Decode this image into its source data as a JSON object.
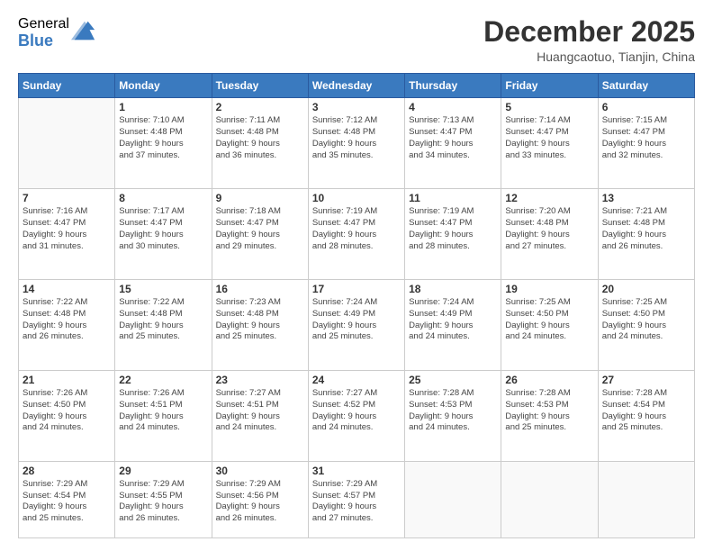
{
  "logo": {
    "general": "General",
    "blue": "Blue"
  },
  "title": "December 2025",
  "location": "Huangcaotuo, Tianjin, China",
  "weekdays": [
    "Sunday",
    "Monday",
    "Tuesday",
    "Wednesday",
    "Thursday",
    "Friday",
    "Saturday"
  ],
  "weeks": [
    [
      {
        "day": "",
        "info": ""
      },
      {
        "day": "1",
        "info": "Sunrise: 7:10 AM\nSunset: 4:48 PM\nDaylight: 9 hours\nand 37 minutes."
      },
      {
        "day": "2",
        "info": "Sunrise: 7:11 AM\nSunset: 4:48 PM\nDaylight: 9 hours\nand 36 minutes."
      },
      {
        "day": "3",
        "info": "Sunrise: 7:12 AM\nSunset: 4:48 PM\nDaylight: 9 hours\nand 35 minutes."
      },
      {
        "day": "4",
        "info": "Sunrise: 7:13 AM\nSunset: 4:47 PM\nDaylight: 9 hours\nand 34 minutes."
      },
      {
        "day": "5",
        "info": "Sunrise: 7:14 AM\nSunset: 4:47 PM\nDaylight: 9 hours\nand 33 minutes."
      },
      {
        "day": "6",
        "info": "Sunrise: 7:15 AM\nSunset: 4:47 PM\nDaylight: 9 hours\nand 32 minutes."
      }
    ],
    [
      {
        "day": "7",
        "info": "Sunrise: 7:16 AM\nSunset: 4:47 PM\nDaylight: 9 hours\nand 31 minutes."
      },
      {
        "day": "8",
        "info": "Sunrise: 7:17 AM\nSunset: 4:47 PM\nDaylight: 9 hours\nand 30 minutes."
      },
      {
        "day": "9",
        "info": "Sunrise: 7:18 AM\nSunset: 4:47 PM\nDaylight: 9 hours\nand 29 minutes."
      },
      {
        "day": "10",
        "info": "Sunrise: 7:19 AM\nSunset: 4:47 PM\nDaylight: 9 hours\nand 28 minutes."
      },
      {
        "day": "11",
        "info": "Sunrise: 7:19 AM\nSunset: 4:47 PM\nDaylight: 9 hours\nand 28 minutes."
      },
      {
        "day": "12",
        "info": "Sunrise: 7:20 AM\nSunset: 4:48 PM\nDaylight: 9 hours\nand 27 minutes."
      },
      {
        "day": "13",
        "info": "Sunrise: 7:21 AM\nSunset: 4:48 PM\nDaylight: 9 hours\nand 26 minutes."
      }
    ],
    [
      {
        "day": "14",
        "info": "Sunrise: 7:22 AM\nSunset: 4:48 PM\nDaylight: 9 hours\nand 26 minutes."
      },
      {
        "day": "15",
        "info": "Sunrise: 7:22 AM\nSunset: 4:48 PM\nDaylight: 9 hours\nand 25 minutes."
      },
      {
        "day": "16",
        "info": "Sunrise: 7:23 AM\nSunset: 4:48 PM\nDaylight: 9 hours\nand 25 minutes."
      },
      {
        "day": "17",
        "info": "Sunrise: 7:24 AM\nSunset: 4:49 PM\nDaylight: 9 hours\nand 25 minutes."
      },
      {
        "day": "18",
        "info": "Sunrise: 7:24 AM\nSunset: 4:49 PM\nDaylight: 9 hours\nand 24 minutes."
      },
      {
        "day": "19",
        "info": "Sunrise: 7:25 AM\nSunset: 4:50 PM\nDaylight: 9 hours\nand 24 minutes."
      },
      {
        "day": "20",
        "info": "Sunrise: 7:25 AM\nSunset: 4:50 PM\nDaylight: 9 hours\nand 24 minutes."
      }
    ],
    [
      {
        "day": "21",
        "info": "Sunrise: 7:26 AM\nSunset: 4:50 PM\nDaylight: 9 hours\nand 24 minutes."
      },
      {
        "day": "22",
        "info": "Sunrise: 7:26 AM\nSunset: 4:51 PM\nDaylight: 9 hours\nand 24 minutes."
      },
      {
        "day": "23",
        "info": "Sunrise: 7:27 AM\nSunset: 4:51 PM\nDaylight: 9 hours\nand 24 minutes."
      },
      {
        "day": "24",
        "info": "Sunrise: 7:27 AM\nSunset: 4:52 PM\nDaylight: 9 hours\nand 24 minutes."
      },
      {
        "day": "25",
        "info": "Sunrise: 7:28 AM\nSunset: 4:53 PM\nDaylight: 9 hours\nand 24 minutes."
      },
      {
        "day": "26",
        "info": "Sunrise: 7:28 AM\nSunset: 4:53 PM\nDaylight: 9 hours\nand 25 minutes."
      },
      {
        "day": "27",
        "info": "Sunrise: 7:28 AM\nSunset: 4:54 PM\nDaylight: 9 hours\nand 25 minutes."
      }
    ],
    [
      {
        "day": "28",
        "info": "Sunrise: 7:29 AM\nSunset: 4:54 PM\nDaylight: 9 hours\nand 25 minutes."
      },
      {
        "day": "29",
        "info": "Sunrise: 7:29 AM\nSunset: 4:55 PM\nDaylight: 9 hours\nand 26 minutes."
      },
      {
        "day": "30",
        "info": "Sunrise: 7:29 AM\nSunset: 4:56 PM\nDaylight: 9 hours\nand 26 minutes."
      },
      {
        "day": "31",
        "info": "Sunrise: 7:29 AM\nSunset: 4:57 PM\nDaylight: 9 hours\nand 27 minutes."
      },
      {
        "day": "",
        "info": ""
      },
      {
        "day": "",
        "info": ""
      },
      {
        "day": "",
        "info": ""
      }
    ]
  ]
}
